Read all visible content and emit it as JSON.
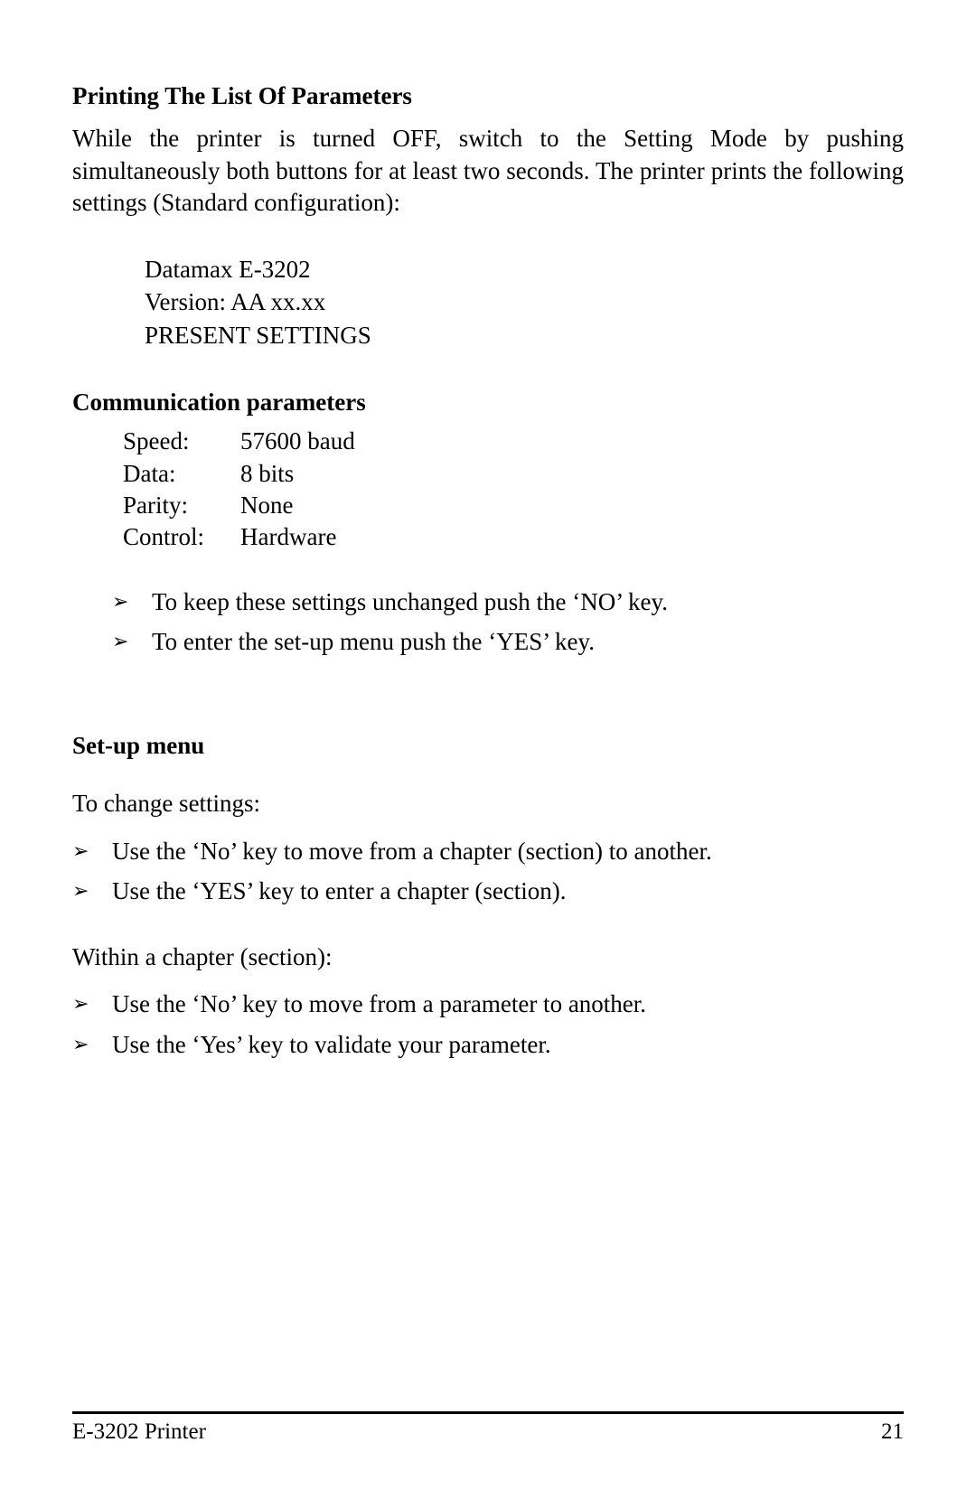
{
  "heading1": "Printing The List Of Parameters",
  "intro": "While the printer is turned OFF, switch to the Setting Mode by pushing simultaneously both buttons for at least two seconds. The printer prints the following settings (Standard configuration):",
  "settings": {
    "line1": "Datamax E-3202",
    "line2": "Version: AA xx.xx",
    "line3": "PRESENT SETTINGS"
  },
  "heading2": "Communication parameters",
  "params": [
    {
      "label": "Speed:",
      "value": "57600 baud"
    },
    {
      "label": "Data:",
      "value": "8 bits"
    },
    {
      "label": "Parity:",
      "value": "None"
    },
    {
      "label": "Control:",
      "value": "Hardware"
    }
  ],
  "instructions1": [
    "To keep these settings unchanged push the ‘NO’ key.",
    "To enter the set-up menu push the ‘YES’ key."
  ],
  "heading3": "Set-up menu",
  "changeSettingsLine": "To change settings:",
  "instructions2": [
    "Use the ‘No’ key to move from a chapter (section) to another.",
    "Use the ‘YES’ key to enter a chapter (section)."
  ],
  "withinChapterLine": "Within a chapter (section):",
  "instructions3": [
    "Use the ‘No’ key to move from a parameter to another.",
    "Use the ‘Yes’ key to validate your parameter."
  ],
  "footer": {
    "left": "E-3202 Printer",
    "right": "21"
  },
  "arrowGlyph": "➢"
}
